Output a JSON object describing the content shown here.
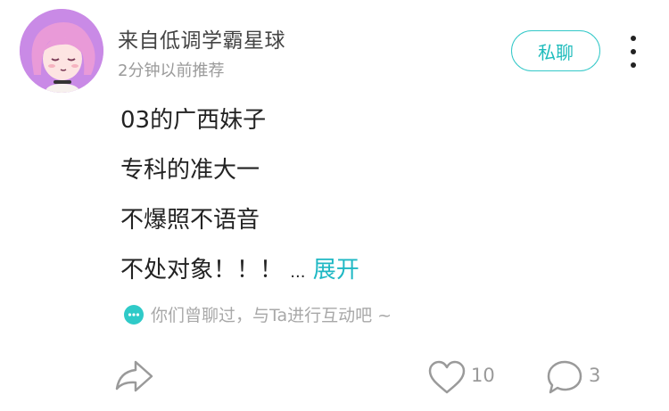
{
  "post": {
    "author": "来自低调学霸星球",
    "time": "2分钟以前推荐",
    "dm_label": "私聊",
    "lines": [
      "03的广西妹子",
      "专科的准大一",
      "不爆照不语音",
      "不处对象！！！"
    ],
    "ellipsis": "...",
    "expand_label": "展开",
    "hint": "你们曾聊过，与Ta进行互动吧 ~",
    "like_count": "10",
    "comment_count": "3"
  },
  "colors": {
    "accent": "#1fb8c4",
    "avatar_bg": "#c98ae6",
    "hint_icon": "#2fcac8"
  },
  "icons": {
    "avatar": "anime-girl-avatar",
    "more": "more-vertical-icon",
    "hint": "chat-bubble-icon",
    "share": "share-icon",
    "like": "heart-icon",
    "comment": "comment-icon"
  }
}
